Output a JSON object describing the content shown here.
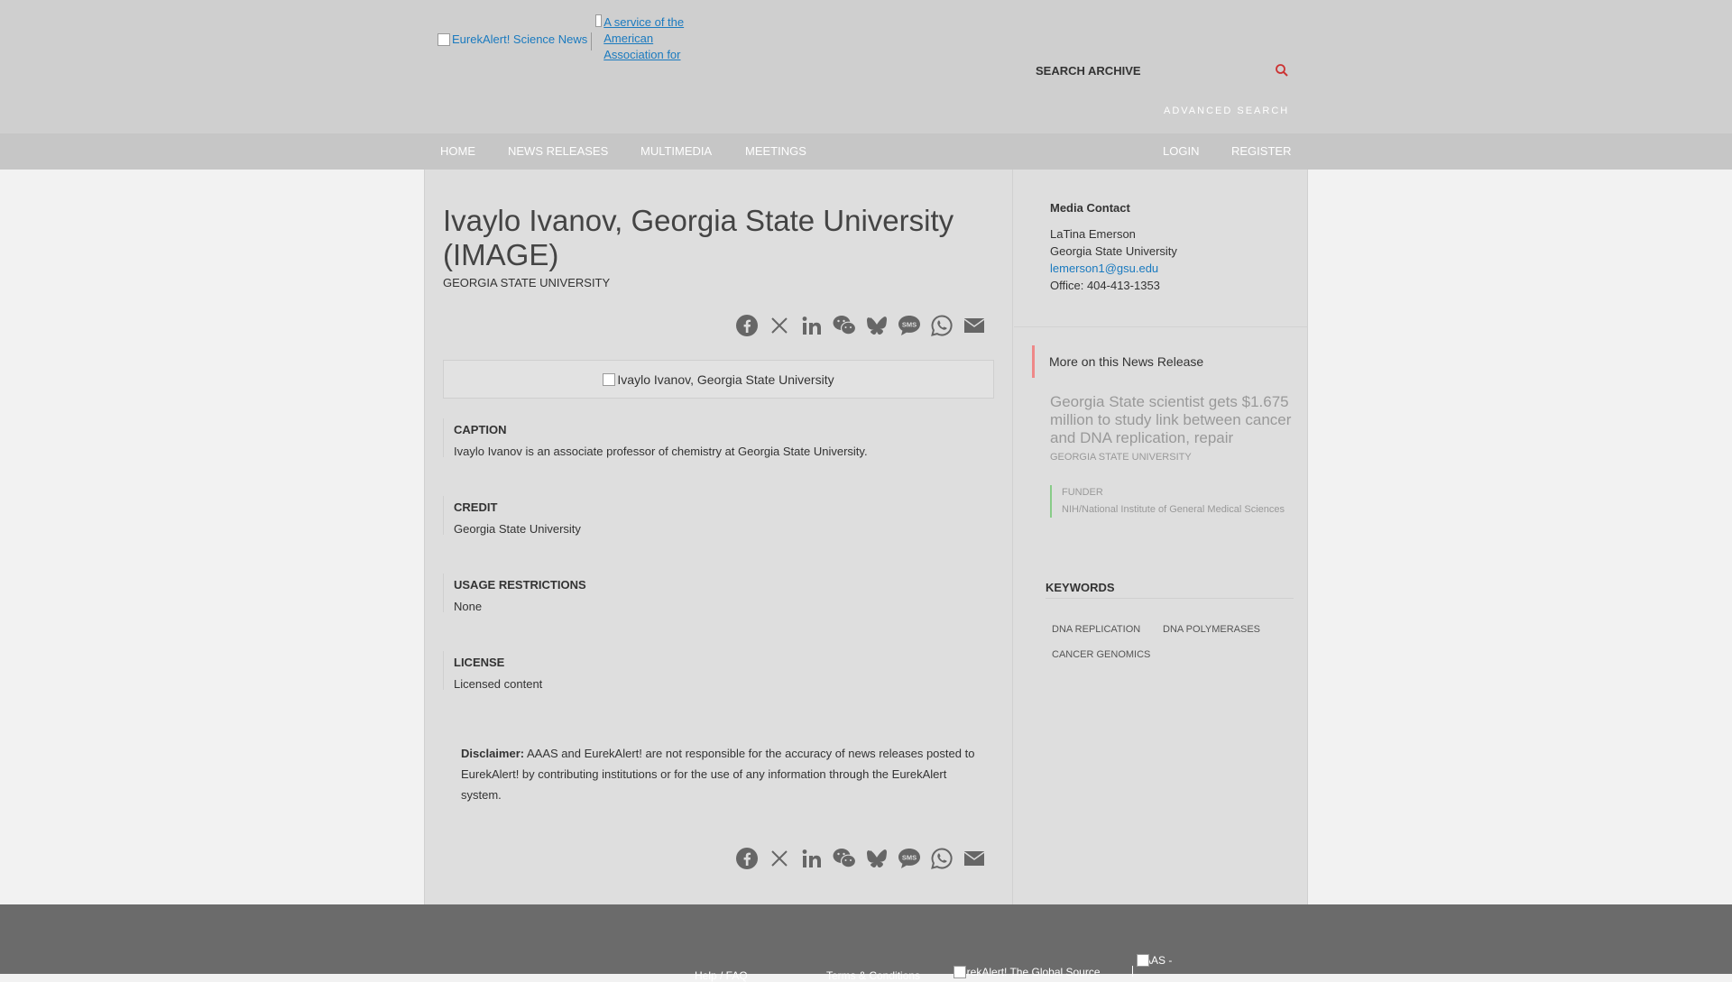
{
  "header": {
    "logo_alt": "EurekAlert! Science News",
    "service_alt": "A service of the American Association for the",
    "search_placeholder": "SEARCH ARCHIVE",
    "advanced_search": "ADVANCED SEARCH"
  },
  "nav": {
    "home": "HOME",
    "news_releases": "NEWS RELEASES",
    "multimedia": "MULTIMEDIA",
    "meetings": "MEETINGS",
    "login": "LOGIN",
    "register": "REGISTER"
  },
  "article": {
    "title": "Ivaylo Ivanov, Georgia State University (IMAGE)",
    "institution": "GEORGIA STATE UNIVERSITY",
    "image_alt": "Ivaylo Ivanov, Georgia State University",
    "caption_label": "CAPTION",
    "caption": "Ivaylo Ivanov is an associate professor of chemistry at Georgia State University.",
    "credit_label": "CREDIT",
    "credit": "Georgia State University",
    "usage_label": "USAGE RESTRICTIONS",
    "usage": "None",
    "license_label": "LICENSE",
    "license": "Licensed content",
    "disclaimer_label": "Disclaimer:",
    "disclaimer_text": " AAAS and EurekAlert! are not responsible for the accuracy of news releases posted to EurekAlert! by contributing institutions or for the use of any information through the EurekAlert system."
  },
  "share_icons": [
    "facebook-icon",
    "x-icon",
    "linkedin-icon",
    "wechat-icon",
    "bluesky-icon",
    "sms-icon",
    "whatsapp-icon",
    "email-icon"
  ],
  "sidebar": {
    "media_contact_label": "Media Contact",
    "contact_name": "LaTina Emerson",
    "contact_org": "Georgia State University",
    "contact_email": "lemerson1@gsu.edu",
    "contact_phone": "Office: 404-413-1353",
    "more_label": "More on this News Release",
    "related_title": "Georgia State scientist gets $1.675 million to study link between cancer and DNA replication, repair",
    "related_institution": "GEORGIA STATE UNIVERSITY",
    "funder_label": "FUNDER",
    "funder_value": "NIH/National Institute of General Medical Sciences",
    "keywords_label": "KEYWORDS",
    "keywords": [
      "DNA REPLICATION",
      "DNA POLYMERASES",
      "CANCER GENOMICS"
    ]
  },
  "footer": {
    "help": "Help / FAQ",
    "terms": "Terms & Conditions",
    "eurekalert_alt": "EurekAlert! The Global Source",
    "aaas_alt": "AAAS -"
  },
  "colors": {
    "link": "#1a7abf",
    "header_bg": "#cfcfcf",
    "footer_bg": "#6b6b6b"
  }
}
